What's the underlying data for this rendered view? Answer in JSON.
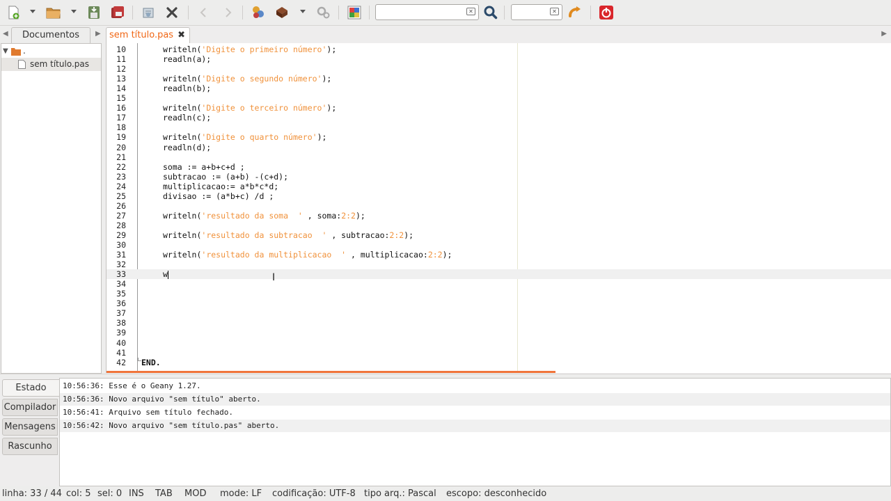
{
  "toolbar": {
    "search_value": "",
    "goto_value": ""
  },
  "sidebar": {
    "tab_label": "Documentos",
    "tree": {
      "folder_label": ".",
      "file_label": "sem título.pas"
    }
  },
  "editor_tab": {
    "label": "sem título.pas",
    "close": "✖"
  },
  "editor": {
    "lines": [
      {
        "n": "10",
        "code": "writeln(",
        "str": "'Digite o primeiro número'",
        "tail": ");"
      },
      {
        "n": "11",
        "code": "readln(a);"
      },
      {
        "n": "12",
        "code": ""
      },
      {
        "n": "13",
        "code": "writeln(",
        "str": "'Digite o segundo número'",
        "tail": ");"
      },
      {
        "n": "14",
        "code": "readln(b);"
      },
      {
        "n": "15",
        "code": ""
      },
      {
        "n": "16",
        "code": "writeln(",
        "str": "'Digite o terceiro número'",
        "tail": ");"
      },
      {
        "n": "17",
        "code": "readln(c);"
      },
      {
        "n": "18",
        "code": ""
      },
      {
        "n": "19",
        "code": "writeln(",
        "str": "'Digite o quarto número'",
        "tail": ");"
      },
      {
        "n": "20",
        "code": "readln(d);"
      },
      {
        "n": "21",
        "code": ""
      },
      {
        "n": "22",
        "code": "soma := a+b+c+d ;"
      },
      {
        "n": "23",
        "code": "subtracao := (a+b) -(c+d);"
      },
      {
        "n": "24",
        "code": "multiplicacao:= a*b*c*d;"
      },
      {
        "n": "25",
        "code": "divisao := (a*b+c) /d ;"
      },
      {
        "n": "26",
        "code": ""
      },
      {
        "n": "27",
        "code": "writeln(",
        "str": "'resultado da soma  '",
        "tail": " , soma:",
        "num": "2:2",
        "tail2": ");"
      },
      {
        "n": "28",
        "code": ""
      },
      {
        "n": "29",
        "code": "writeln(",
        "str": "'resultado da subtracao  '",
        "tail": " , subtracao:",
        "num": "2:2",
        "tail2": ");"
      },
      {
        "n": "30",
        "code": ""
      },
      {
        "n": "31",
        "code": "writeln(",
        "str": "'resultado da multiplicacao  '",
        "tail": " , multiplicacao:",
        "num": "2:2",
        "tail2": ");"
      },
      {
        "n": "32",
        "code": ""
      },
      {
        "n": "33",
        "code": "w",
        "current": true
      },
      {
        "n": "34",
        "code": ""
      },
      {
        "n": "35",
        "code": ""
      },
      {
        "n": "36",
        "code": ""
      },
      {
        "n": "37",
        "code": ""
      },
      {
        "n": "38",
        "code": ""
      },
      {
        "n": "39",
        "code": ""
      },
      {
        "n": "40",
        "code": ""
      },
      {
        "n": "41",
        "code": ""
      },
      {
        "n": "42",
        "code": "END.",
        "end": true
      }
    ]
  },
  "messages": {
    "tabs": [
      "Estado",
      "Compilador",
      "Mensagens",
      "Rascunho"
    ],
    "rows": [
      "10:56:36: Esse é o Geany 1.27.",
      "10:56:36: Novo arquivo \"sem título\" aberto.",
      "10:56:41: Arquivo sem título fechado.",
      "10:56:42: Novo arquivo \"sem título.pas\" aberto."
    ]
  },
  "status": {
    "line": "linha: 33 / 44",
    "col": "col: 5",
    "sel": "sel: 0",
    "ins": "INS",
    "tab": "TAB",
    "mod": "MOD",
    "mode": "mode: LF",
    "encoding": "codificação: UTF-8",
    "filetype": "tipo arq.: Pascal",
    "scope": "escopo: desconhecido"
  },
  "colors": {
    "accent": "#f06614",
    "string": "#f0913a",
    "quit": "#d9262b"
  }
}
